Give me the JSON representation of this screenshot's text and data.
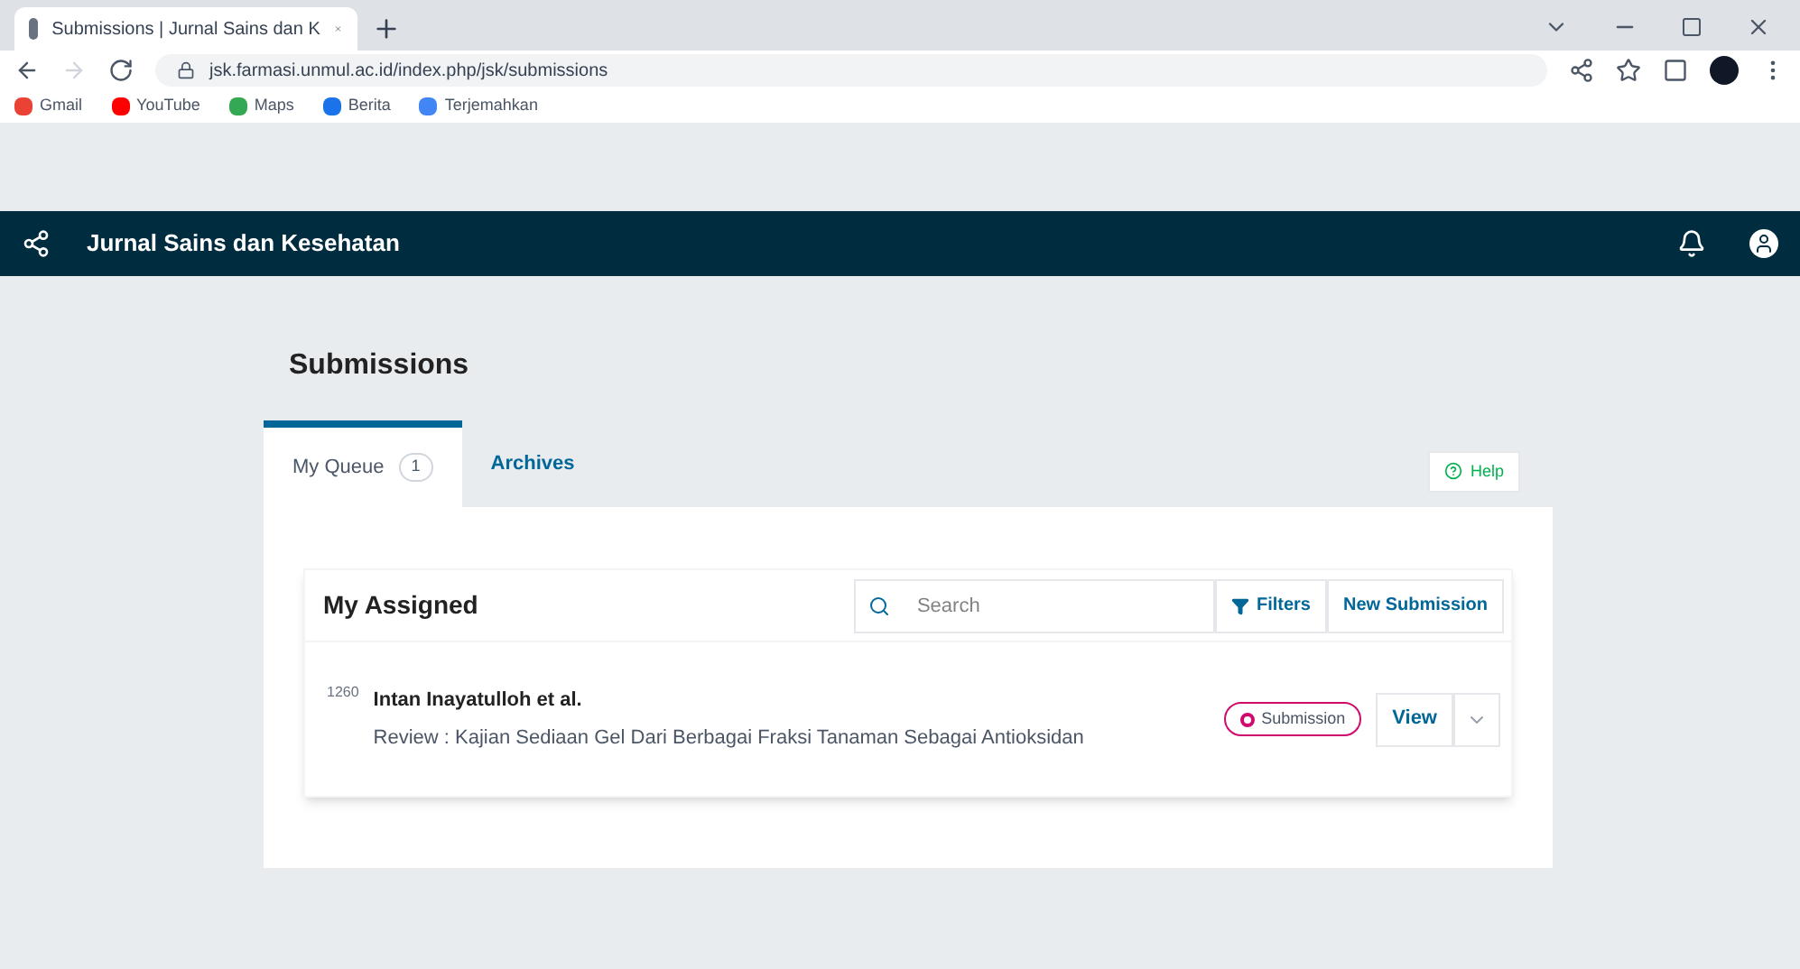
{
  "browser": {
    "tab_title": "Submissions | Jurnal Sains dan K",
    "url": "jsk.farmasi.unmul.ac.id/index.php/jsk/submissions",
    "bookmarks": [
      "Gmail",
      "YouTube",
      "Maps",
      "Berita",
      "Terjemahkan"
    ]
  },
  "header": {
    "title": "Jurnal Sains dan Kesehatan"
  },
  "page": {
    "title": "Submissions",
    "tabs": [
      {
        "label": "My Queue",
        "count": "1",
        "selected": true
      },
      {
        "label": "Archives",
        "selected": false
      }
    ],
    "help": "Help",
    "list": {
      "title": "My Assigned",
      "search": {
        "placeholder": "Search"
      },
      "filters": "Filters",
      "new_submission": "New Submission",
      "items": [
        {
          "id": "1260",
          "authors": "Intan Inayatulloh et al.",
          "title": "Review : Kajian Sediaan Gel Dari Berbagai Fraksi Tanaman Sebagai Antioksidan",
          "stage": "Submission",
          "action": "View"
        }
      ]
    }
  }
}
